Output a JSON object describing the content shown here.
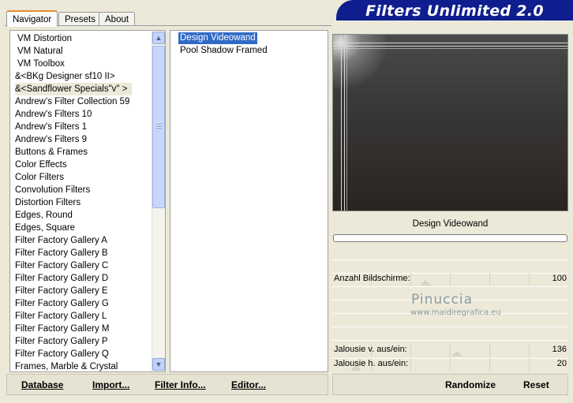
{
  "tabs": [
    "Navigator",
    "Presets",
    "About"
  ],
  "banner": "Filters Unlimited 2.0",
  "categories": [
    "VM Distortion",
    "VM Natural",
    "VM Toolbox",
    "&<BKg Designer sf10 II>",
    "&<Sandflower Specials\"v\" >",
    "Andrew's Filter Collection 59",
    "Andrew's Filters 10",
    "Andrew's Filters 1",
    "Andrew's Filters 9",
    "Buttons & Frames",
    "Color Effects",
    "Color Filters",
    "Convolution Filters",
    "Distortion Filters",
    "Edges, Round",
    "Edges, Square",
    "Filter Factory Gallery A",
    "Filter Factory Gallery B",
    "Filter Factory Gallery C",
    "Filter Factory Gallery D",
    "Filter Factory Gallery E",
    "Filter Factory Gallery G",
    "Filter Factory Gallery L",
    "Filter Factory Gallery M",
    "Filter Factory Gallery P",
    "Filter Factory Gallery Q",
    "Frames, Marble & Crystal"
  ],
  "selected_category_index": 4,
  "filters": [
    "Design Videowand",
    "Pool Shadow Framed"
  ],
  "selected_filter_index": 0,
  "filter_name": "Design Videowand",
  "sliders": [
    {
      "label": "Anzahl Bildschirme:",
      "value": "100",
      "level": 0.39
    },
    {
      "label": "Jalousie v. aus/ein:",
      "value": "136",
      "level": 0.53
    },
    {
      "label": "Jalousie h. aus/ein:",
      "value": "20",
      "level": 0.08
    }
  ],
  "watermark": {
    "line1": "Pinuccia",
    "line2": "www.maidiregrafica.eu"
  },
  "buttons": {
    "database": "Database",
    "import": "Import...",
    "filter_info": "Filter Info...",
    "editor": "Editor...",
    "randomize": "Randomize",
    "reset": "Reset"
  },
  "colors": {
    "banner": "#0f1d8f",
    "selection": "#316ac5",
    "tab_accent": "#e68b2c"
  },
  "icons": [
    "scroll-up-arrow-icon",
    "scroll-down-arrow-icon"
  ]
}
